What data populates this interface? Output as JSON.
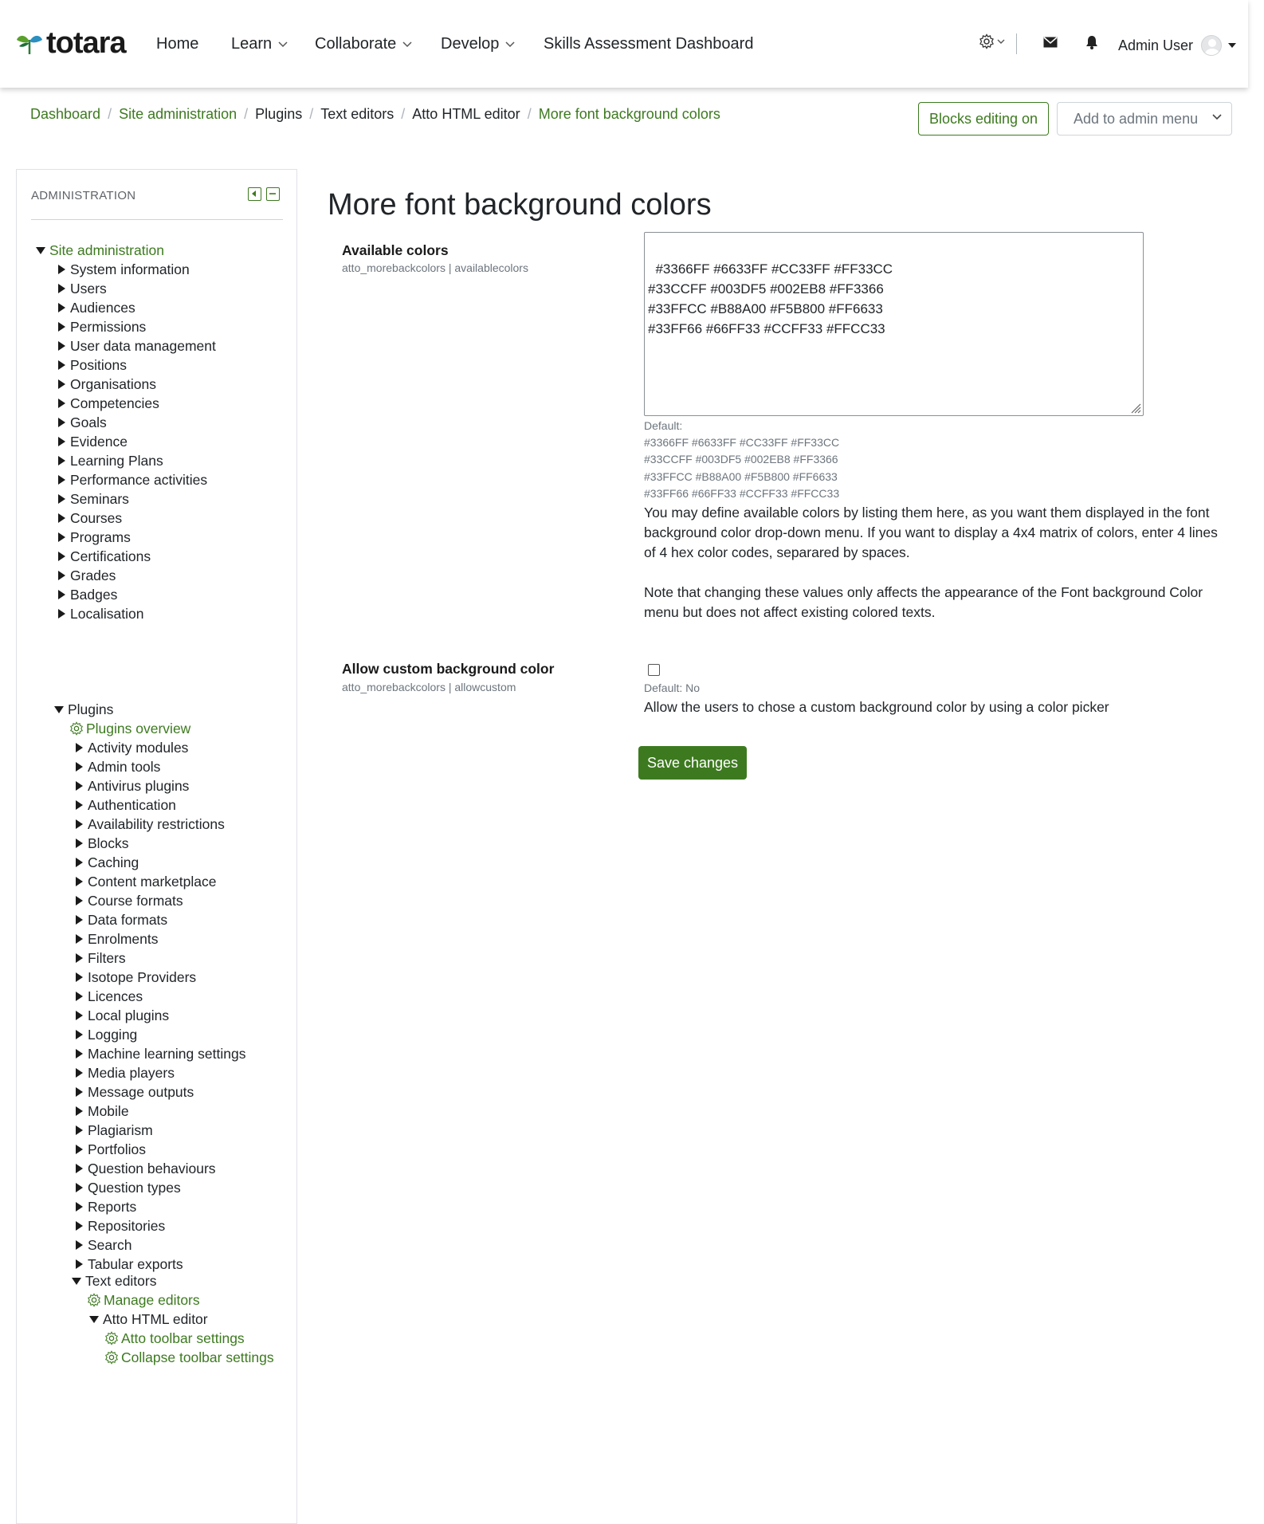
{
  "brand": {
    "name": "totara"
  },
  "nav": {
    "home": "Home",
    "learn": "Learn",
    "collaborate": "Collaborate",
    "develop": "Develop",
    "skills": "Skills Assessment Dashboard",
    "user_name": "Admin User"
  },
  "breadcrumb": {
    "items": [
      "Dashboard",
      "Site administration",
      "Plugins",
      "Text editors",
      "Atto HTML editor",
      "More font background colors"
    ]
  },
  "header_actions": {
    "blocks_editing": "Blocks editing on",
    "admin_menu": "Add to admin menu"
  },
  "sidebar": {
    "title": "ADMINISTRATION",
    "root": "Site administration",
    "items": [
      "System information",
      "Users",
      "Audiences",
      "Permissions",
      "User data management",
      "Positions",
      "Organisations",
      "Competencies",
      "Goals",
      "Evidence",
      "Learning Plans",
      "Performance activities",
      "Seminars",
      "Courses",
      "Programs",
      "Certifications",
      "Grades",
      "Badges",
      "Localisation"
    ],
    "plugins": "Plugins",
    "plugins_overview": "Plugins overview",
    "plugin_items": [
      "Activity modules",
      "Admin tools",
      "Antivirus plugins",
      "Authentication",
      "Availability restrictions",
      "Blocks",
      "Caching",
      "Content marketplace",
      "Course formats",
      "Data formats",
      "Enrolments",
      "Filters",
      "Isotope Providers",
      "Licences",
      "Local plugins",
      "Logging",
      "Machine learning settings",
      "Media players",
      "Message outputs",
      "Mobile",
      "Plagiarism",
      "Portfolios",
      "Question behaviours",
      "Question types",
      "Reports",
      "Repositories",
      "Search",
      "Tabular exports"
    ],
    "text_editors": "Text editors",
    "manage_editors": "Manage editors",
    "atto": "Atto HTML editor",
    "atto_items": [
      "Atto toolbar settings",
      "Collapse toolbar settings"
    ]
  },
  "page": {
    "title": "More font background colors",
    "available_colors": {
      "label": "Available colors",
      "id": "atto_morebackcolors | availablecolors",
      "value": "#3366FF #6633FF #CC33FF #FF33CC\n#33CCFF #003DF5 #002EB8 #FF3366\n#33FFCC #B88A00 #F5B800 #FF6633\n#33FF66 #66FF33 #CCFF33 #FFCC33",
      "default_label": "Default:",
      "default_lines": [
        "#3366FF #6633FF #CC33FF #FF33CC",
        "#33CCFF #003DF5 #002EB8 #FF3366",
        "#33FFCC #B88A00 #F5B800 #FF6633",
        "#33FF66 #66FF33 #CCFF33 #FFCC33"
      ],
      "description_1": "You may define available colors by listing them here, as you want them displayed in the font background color drop-down menu. If you want to display a 4x4 matrix of colors, enter 4 lines of 4 hex color codes, separared by spaces.",
      "description_2": "Note that changing these values only affects the appearance of the Font background Color menu but does not affect existing colored texts."
    },
    "allow_custom": {
      "label": "Allow custom background color",
      "id": "atto_morebackcolors | allowcustom",
      "default": "Default: No",
      "description": "Allow the users to chose a custom background color by using a color picker",
      "checked": false
    },
    "save": "Save changes"
  },
  "colors": {
    "accent": "#3d7a1f",
    "text": "#212529",
    "muted": "#6c757d"
  }
}
